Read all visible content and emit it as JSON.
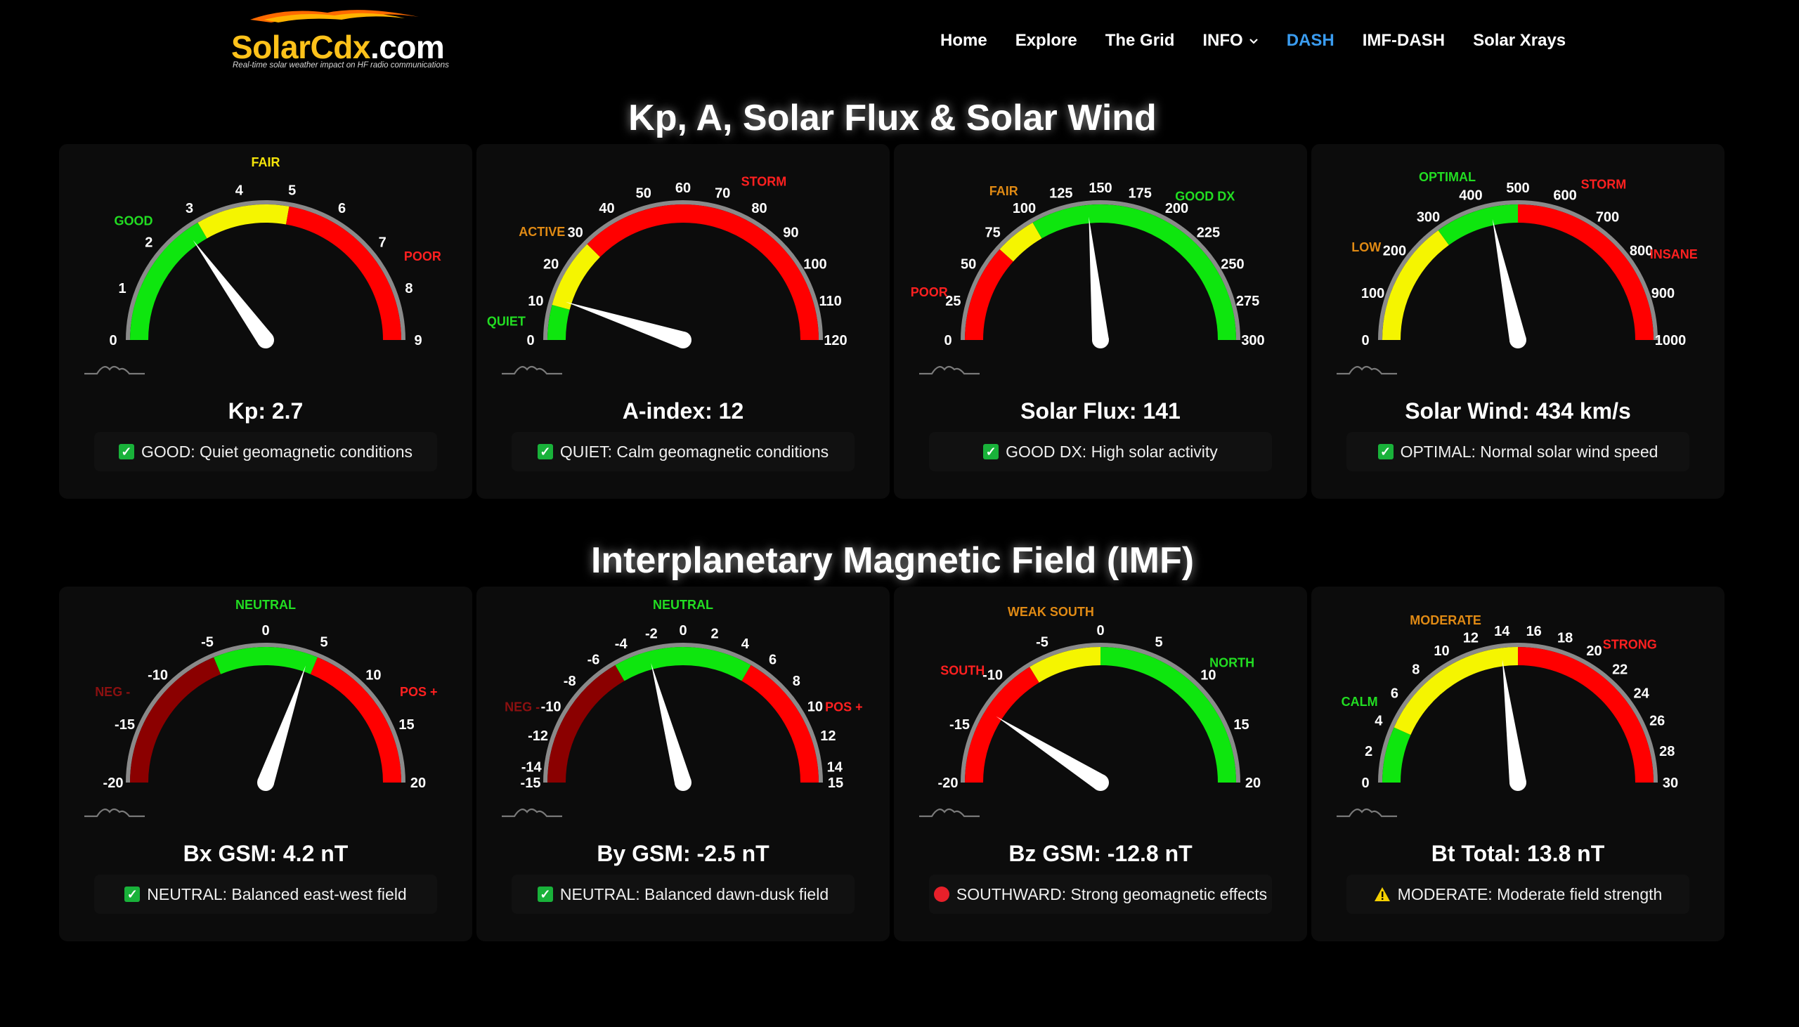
{
  "header": {
    "logo": {
      "part1": "SolarCdx",
      "part2": ".com",
      "tagline": "Real-time solar weather impact on HF radio communications"
    },
    "nav": [
      {
        "label": "Home"
      },
      {
        "label": "Explore"
      },
      {
        "label": "The Grid"
      },
      {
        "label": "INFO",
        "dropdown": true
      },
      {
        "label": "DASH",
        "active": true
      },
      {
        "label": "IMF-DASH"
      },
      {
        "label": "Solar Xrays"
      }
    ]
  },
  "sections": {
    "kp": {
      "title": "Kp, A, Solar Flux & Solar Wind"
    },
    "imf": {
      "title": "Interplanetary Magnetic Field (IMF)"
    }
  },
  "colors": {
    "green": "#0ee60e",
    "yellow": "#f5f500",
    "red": "#ff0000",
    "darkred": "#8b0000",
    "orange": "#e08a14",
    "label_green": "#22dd22",
    "label_red": "#ff2020",
    "label_darkred": "#8b1010",
    "label_yellow": "#f5e40a"
  },
  "gauges": [
    {
      "id": "kp",
      "value_text": "Kp: 2.7",
      "status_icon": "check-icon",
      "status_text": "GOOD: Quiet geomagnetic conditions",
      "min": 0,
      "max": 9,
      "value": 2.7,
      "bands": [
        {
          "from": 0,
          "to": 3,
          "color": "green"
        },
        {
          "from": 3,
          "to": 5,
          "color": "yellow"
        },
        {
          "from": 5,
          "to": 9,
          "color": "red"
        }
      ],
      "ticks": [
        0,
        1,
        2,
        3,
        4,
        5,
        6,
        7,
        8,
        9
      ],
      "labels": [
        {
          "text": "GOOD",
          "at": 2.1,
          "color": "label_green"
        },
        {
          "text": "FAIR",
          "at": 4.5,
          "color": "label_yellow"
        },
        {
          "text": "POOR",
          "at": 7.6,
          "color": "label_red"
        }
      ]
    },
    {
      "id": "a",
      "value_text": "A-index: 12",
      "status_icon": "check-icon",
      "status_text": "QUIET: Calm geomagnetic conditions",
      "min": 0,
      "max": 120,
      "value": 12,
      "bands": [
        {
          "from": 0,
          "to": 10,
          "color": "green"
        },
        {
          "from": 10,
          "to": 30,
          "color": "yellow"
        },
        {
          "from": 30,
          "to": 120,
          "color": "red"
        }
      ],
      "ticks": [
        0,
        10,
        20,
        30,
        40,
        50,
        60,
        70,
        80,
        90,
        100,
        110,
        120
      ],
      "labels": [
        {
          "text": "QUIET",
          "at": 4,
          "color": "label_green"
        },
        {
          "text": "ACTIVE",
          "at": 25,
          "color": "orange"
        },
        {
          "text": "STORM",
          "at": 78,
          "color": "label_red"
        }
      ]
    },
    {
      "id": "sfi",
      "value_text": "Solar Flux: 141",
      "status_icon": "check-icon",
      "status_text": "GOOD DX: High solar activity",
      "min": 0,
      "max": 300,
      "value": 141,
      "bands": [
        {
          "from": 0,
          "to": 70,
          "color": "red"
        },
        {
          "from": 70,
          "to": 100,
          "color": "yellow"
        },
        {
          "from": 100,
          "to": 300,
          "color": "green"
        }
      ],
      "ticks": [
        0,
        25,
        50,
        75,
        100,
        125,
        150,
        175,
        200,
        225,
        250,
        275,
        300
      ],
      "labels": [
        {
          "text": "POOR",
          "at": 26,
          "color": "label_red"
        },
        {
          "text": "FAIR",
          "at": 95,
          "color": "orange"
        },
        {
          "text": "GOOD DX",
          "at": 210,
          "color": "label_green"
        }
      ]
    },
    {
      "id": "wind",
      "value_text": "Solar Wind: 434 km/s",
      "status_icon": "check-icon",
      "status_text": "OPTIMAL: Normal solar wind speed",
      "min": 0,
      "max": 1000,
      "value": 434,
      "bands": [
        {
          "from": 0,
          "to": 300,
          "color": "yellow"
        },
        {
          "from": 300,
          "to": 500,
          "color": "green"
        },
        {
          "from": 500,
          "to": 1000,
          "color": "red"
        }
      ],
      "ticks": [
        0,
        100,
        200,
        300,
        400,
        500,
        600,
        700,
        800,
        900,
        1000
      ],
      "labels": [
        {
          "text": "LOW",
          "at": 175,
          "color": "orange"
        },
        {
          "text": "OPTIMAL",
          "at": 370,
          "color": "label_green"
        },
        {
          "text": "STORM",
          "at": 660,
          "color": "label_red"
        },
        {
          "text": "INSANE",
          "at": 840,
          "color": "label_red"
        }
      ]
    },
    {
      "id": "bx",
      "value_text": "Bx GSM: 4.2 nT",
      "status_icon": "check-icon",
      "status_text": "NEUTRAL: Balanced east-west field",
      "min": -20,
      "max": 20,
      "value": 4.2,
      "bands": [
        {
          "from": -20,
          "to": -5,
          "color": "darkred"
        },
        {
          "from": -5,
          "to": 5,
          "color": "green"
        },
        {
          "from": 5,
          "to": 20,
          "color": "red"
        }
      ],
      "ticks": [
        -20,
        -15,
        -10,
        -5,
        0,
        5,
        10,
        15,
        20
      ],
      "labels": [
        {
          "text": "NEG -",
          "at": -13.2,
          "color": "label_darkred"
        },
        {
          "text": "NEUTRAL",
          "at": 0,
          "color": "label_green"
        },
        {
          "text": "POS +",
          "at": 13.2,
          "color": "label_red"
        }
      ]
    },
    {
      "id": "by",
      "value_text": "By GSM: -2.5 nT",
      "status_icon": "check-icon",
      "status_text": "NEUTRAL: Balanced dawn-dusk field",
      "min": -15,
      "max": 15,
      "value": -2.5,
      "bands": [
        {
          "from": -15,
          "to": -5,
          "color": "darkred"
        },
        {
          "from": -5,
          "to": 5,
          "color": "green"
        },
        {
          "from": 5,
          "to": 15,
          "color": "red"
        }
      ],
      "ticks": [
        -15,
        -14,
        -12,
        -10,
        -8,
        -6,
        -4,
        -2,
        0,
        2,
        4,
        6,
        8,
        10,
        12,
        14,
        15
      ],
      "labels": [
        {
          "text": "NEG -",
          "at": -10.8,
          "color": "label_darkred"
        },
        {
          "text": "NEUTRAL",
          "at": 0,
          "color": "label_green"
        },
        {
          "text": "POS +",
          "at": 10.8,
          "color": "label_red"
        }
      ]
    },
    {
      "id": "bz",
      "value_text": "Bz GSM: -12.8 nT",
      "status_icon": "circle-icon",
      "status_text": "SOUTHWARD: Strong geomagnetic effects",
      "min": -20,
      "max": 20,
      "value": -12.8,
      "bands": [
        {
          "from": -20,
          "to": -7,
          "color": "red"
        },
        {
          "from": -7,
          "to": 0,
          "color": "yellow"
        },
        {
          "from": 0,
          "to": 20,
          "color": "green"
        }
      ],
      "ticks": [
        -20,
        -15,
        -10,
        -5,
        0,
        5,
        10,
        15,
        20
      ],
      "labels": [
        {
          "text": "SOUTH",
          "at": -11.3,
          "color": "label_red"
        },
        {
          "text": "WEAK SOUTH",
          "at": -3.6,
          "color": "orange"
        },
        {
          "text": "NORTH",
          "at": 10.6,
          "color": "label_green"
        }
      ]
    },
    {
      "id": "bt",
      "value_text": "Bt Total: 13.8 nT",
      "status_icon": "warning-icon",
      "status_text": "MODERATE: Moderate field strength",
      "min": 0,
      "max": 30,
      "value": 13.8,
      "bands": [
        {
          "from": 0,
          "to": 4,
          "color": "green"
        },
        {
          "from": 4,
          "to": 15,
          "color": "yellow"
        },
        {
          "from": 15,
          "to": 30,
          "color": "red"
        }
      ],
      "ticks": [
        0,
        2,
        4,
        6,
        8,
        10,
        12,
        14,
        16,
        18,
        20,
        22,
        24,
        26,
        28,
        30
      ],
      "labels": [
        {
          "text": "CALM",
          "at": 4.5,
          "color": "label_green"
        },
        {
          "text": "MODERATE",
          "at": 11,
          "color": "orange"
        },
        {
          "text": "STRONG",
          "at": 21.5,
          "color": "label_red"
        }
      ]
    }
  ]
}
